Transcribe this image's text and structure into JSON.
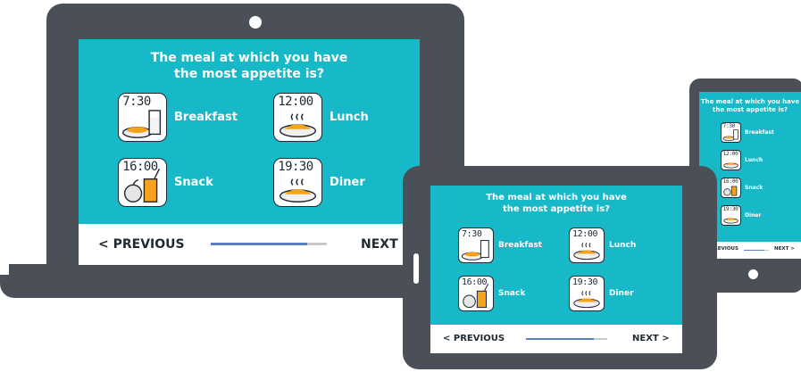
{
  "theme": {
    "device": "#4b4f57",
    "screen": "#17b8c7",
    "progress": "#5b7fbf",
    "track": "#c9c9c9"
  },
  "survey": {
    "question_line1": "The meal at which you have",
    "question_line2": "the most appetite is?",
    "options": [
      {
        "label": "Breakfast",
        "time": "7:30",
        "icon": "breakfast-plate-glass-icon"
      },
      {
        "label": "Lunch",
        "time": "12:00",
        "icon": "lunch-steaming-plate-icon"
      },
      {
        "label": "Snack",
        "time": "16:00",
        "icon": "snack-apple-juice-icon"
      },
      {
        "label": "Diner",
        "time": "19:30",
        "icon": "dinner-steaming-plate-icon"
      }
    ],
    "prev_label": "PREVIOUS",
    "next_label": "NEXT",
    "progress": 0.83
  }
}
